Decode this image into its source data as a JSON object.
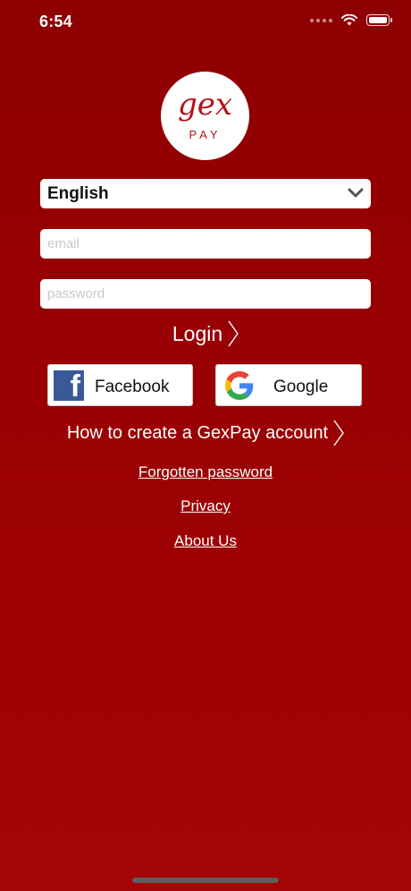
{
  "status_bar": {
    "time": "6:54"
  },
  "logo": {
    "brand_script": "gex",
    "brand_sub": "PAY"
  },
  "language": {
    "selected": "English"
  },
  "email": {
    "placeholder": "email",
    "value": ""
  },
  "password": {
    "placeholder": "password",
    "value": ""
  },
  "login": {
    "label": "Login"
  },
  "social": {
    "facebook_label": "Facebook",
    "google_label": "Google"
  },
  "howto": {
    "label": "How to create a GexPay account"
  },
  "links": {
    "forgot": "Forgotten password",
    "privacy": "Privacy",
    "about": "About Us"
  },
  "colors": {
    "background": "#9a0003",
    "logo_red": "#b5121b",
    "facebook_blue": "#3b5998"
  },
  "icons": [
    "wifi-icon",
    "battery-icon",
    "chevron-down-icon",
    "chevron-right-icon",
    "facebook-icon",
    "google-icon"
  ]
}
